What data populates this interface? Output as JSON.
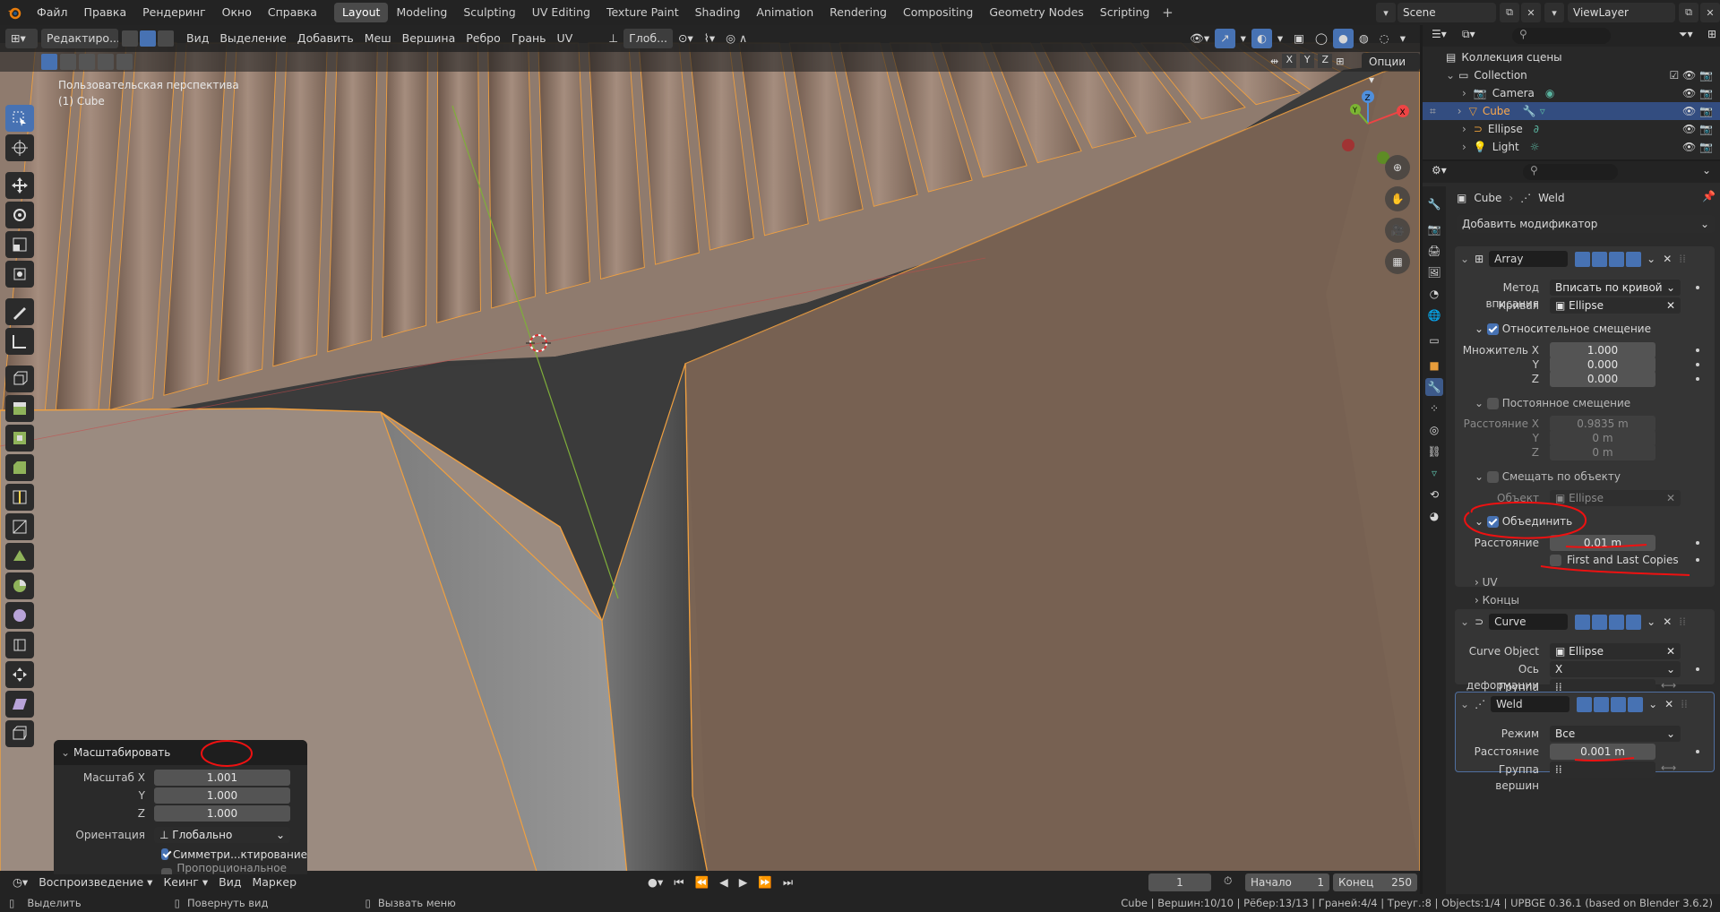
{
  "top_menu": {
    "items": [
      "Файл",
      "Правка",
      "Рендеринг",
      "Окно",
      "Справка"
    ],
    "workspaces": [
      "Layout",
      "Modeling",
      "Sculpting",
      "UV Editing",
      "Texture Paint",
      "Shading",
      "Animation",
      "Rendering",
      "Compositing",
      "Geometry Nodes",
      "Scripting"
    ],
    "active_workspace": "Layout",
    "scene": "Scene",
    "view_layer": "ViewLayer"
  },
  "viewport_header": {
    "mode": "Редактиро...",
    "menus": [
      "Вид",
      "Выделение",
      "Добавить",
      "Меш",
      "Вершина",
      "Ребро",
      "Грань",
      "UV"
    ],
    "transform_orientation": "Глоб...",
    "mirror_axes": [
      "X",
      "Y",
      "Z"
    ],
    "options": "Опции"
  },
  "viewport": {
    "view_name": "Пользовательская перспектива",
    "object_name": "(1) Cube"
  },
  "operator_panel": {
    "title": "Масштабировать",
    "scale_x_label": "Масштаб X",
    "scale_x": "1.001",
    "y_label": "Y",
    "scale_y": "1.000",
    "z_label": "Z",
    "scale_z": "1.000",
    "orientation_label": "Ориентация",
    "orientation": "Глобально",
    "symmetry": "Симметри...ктирование",
    "proportional": "Пропорциональное ре..."
  },
  "timeline": {
    "playback": "Воспроизведение",
    "keying": "Кеинг",
    "view": "Вид",
    "marker": "Маркер",
    "current_frame": "1",
    "start_label": "Начало",
    "start": "1",
    "end_label": "Конец",
    "end": "250"
  },
  "statusbar": {
    "select": "Выделить",
    "rotate": "Повернуть вид",
    "menu": "Вызвать меню",
    "stats": "Cube | Вершин:10/10 | Рёбер:13/13 | Граней:4/4 | Треуг.:8 | Objects:1/4 | UPBGE 0.36.1 (based on Blender 3.6.2)"
  },
  "outliner": {
    "root": "Коллекция сцены",
    "collection": "Collection",
    "objects": [
      "Camera",
      "Cube",
      "Ellipse",
      "Light"
    ],
    "selected": "Cube"
  },
  "properties": {
    "breadcrumb_object": "Cube",
    "breadcrumb_modifier": "Weld",
    "add_modifier": "Добавить модификатор",
    "array": {
      "name": "Array",
      "fit_method_label": "Метод вписания",
      "fit_method": "Вписать по кривой",
      "curve_label": "Кривая",
      "curve": "Ellipse",
      "relative_offset": "Относительное смещение",
      "mult_x_label": "Множитель X",
      "mult_x": "1.000",
      "y_label": "Y",
      "mult_y": "0.000",
      "z_label": "Z",
      "mult_z": "0.000",
      "constant_offset": "Постоянное смещение",
      "dist_x_label": "Расстояние X",
      "dist_x": "0.9835 m",
      "dist_y": "0 m",
      "dist_z": "0 m",
      "object_offset": "Смещать по объекту",
      "object_label": "Объект",
      "object": "Ellipse",
      "merge": "Объединить",
      "distance_label": "Расстояние",
      "distance": "0.01 m",
      "first_last": "First and Last Copies",
      "uv": "UV",
      "caps": "Концы"
    },
    "curve": {
      "name": "Curve",
      "curve_object_label": "Curve Object",
      "curve_object": "Ellipse",
      "deform_axis_label": "Ось деформации",
      "deform_axis": "X",
      "vertex_group_label": "Группа вершин"
    },
    "weld": {
      "name": "Weld",
      "mode_label": "Режим",
      "mode": "Все",
      "distance_label": "Расстояние",
      "distance": "0.001 m",
      "vertex_group_label": "Группа вершин"
    }
  },
  "colors": {
    "accent": "#4772b3",
    "edit_wire": "#f0a040",
    "annotation": "#e01010"
  }
}
